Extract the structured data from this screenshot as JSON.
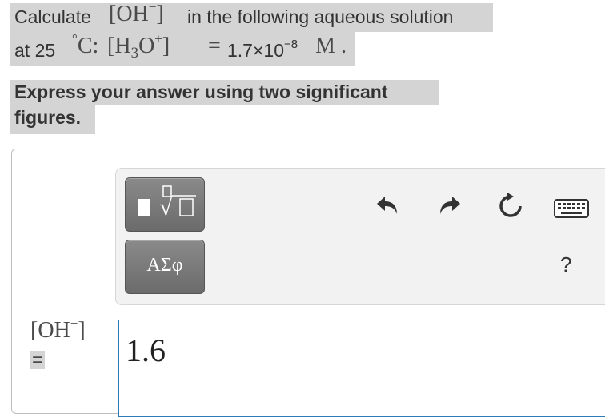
{
  "question": {
    "line1_pre": "Calculate",
    "line1_ion_base": "OH",
    "line1_ion_charge": "−",
    "line1_post": "in the following aqueous solution",
    "line2_pre": "at 25",
    "line2_degree": "°",
    "line2_unit": "C:",
    "line2_ion_base": "H",
    "line2_ion_sub": "3",
    "line2_ion_o": "O",
    "line2_ion_charge": "+",
    "line2_equals": "=",
    "line2_value_mantissa": "1.7×10",
    "line2_value_exp": "−8",
    "line2_value_unit": "M",
    "line2_period": "."
  },
  "instructions": {
    "line1": "Express your answer using two significant",
    "line2": "figures."
  },
  "toolbar": {
    "templates_button": "templates-radical",
    "symbols_button_label": "ΑΣφ",
    "undo": "undo-icon",
    "redo": "redo-icon",
    "reset": "reset-icon",
    "keyboard": "keyboard-icon",
    "help_label": "?"
  },
  "answer": {
    "label_base": "OH",
    "label_charge": "−",
    "equals": "=",
    "value": "1.6"
  }
}
